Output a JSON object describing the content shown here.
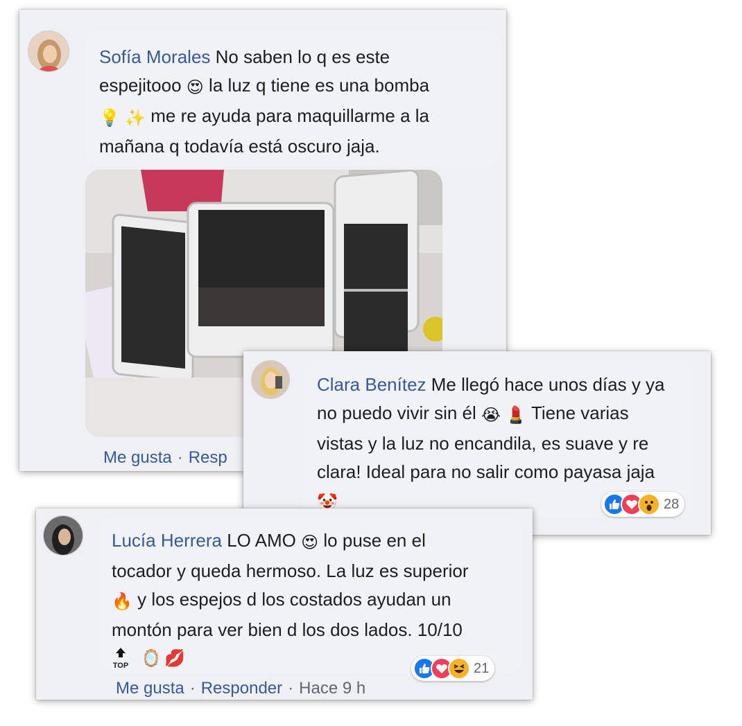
{
  "comments": [
    {
      "author": "Sofía Morales",
      "lines": [
        "No saben lo q es este",
        "espejitooo",
        "la luz q tiene es una bomba",
        "me re ayuda para maquillarme a la",
        "mañana q todavía está oscuro jaja."
      ],
      "emojis": [
        "😍",
        "💡",
        "✨"
      ],
      "actions": {
        "like": "Me gusta",
        "dot": "·",
        "reply": "Resp"
      }
    },
    {
      "author": "Clara Benítez",
      "lines": [
        "Me llegó hace unos días y ya",
        "no puedo vivir sin él",
        "Tiene varias",
        "vistas y la luz no encandila, es suave y re",
        "clara! Ideal para no salir como payasa jaja"
      ],
      "emojis": [
        "😭",
        "💄",
        "🤡"
      ],
      "reactions": {
        "icons": [
          "like-icon",
          "love-icon",
          "wow-icon"
        ],
        "count": "28"
      }
    },
    {
      "author": "Lucía Herrera",
      "lines": [
        "LO AMO",
        "lo puse en el",
        "tocador y queda hermoso. La luz es superior",
        "y los espejos d los costados ayudan un",
        "montón para ver bien d los dos lados. 10/10"
      ],
      "emojis": [
        "😍",
        "🔥",
        "🔝",
        "🪞",
        "💋"
      ],
      "top_label": "TOP",
      "reactions": {
        "icons": [
          "like-icon",
          "love-icon",
          "haha-icon"
        ],
        "count": "21"
      },
      "actions": {
        "like": "Me gusta",
        "dot": "·",
        "reply": "Responder",
        "time": "Hace 9 h"
      }
    }
  ],
  "colors": {
    "name": "#385898",
    "bubble": "#f0f2f5",
    "like": "#1877f2",
    "love": "#f33e58",
    "wow": "#f7b125"
  }
}
